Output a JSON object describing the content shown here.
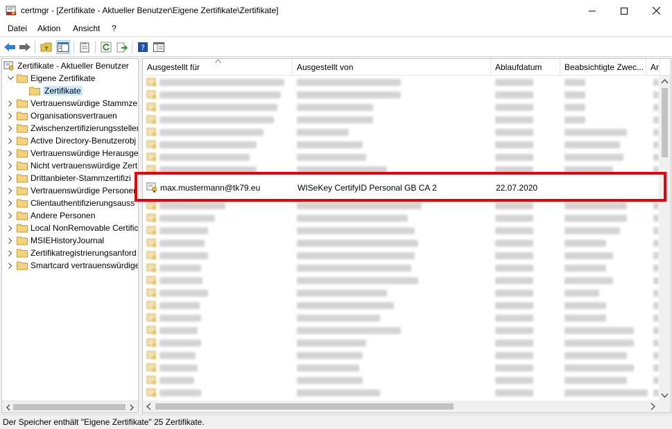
{
  "window": {
    "title": "certmgr - [Zertifikate - Aktueller Benutzer\\Eigene Zertifikate\\Zertifikate]",
    "icon": "certificate-manager-icon"
  },
  "menu": {
    "items": [
      {
        "label": "Datei"
      },
      {
        "label": "Aktion"
      },
      {
        "label": "Ansicht"
      },
      {
        "label": "?"
      }
    ]
  },
  "toolbar": {
    "icons": [
      "back-arrow-icon",
      "forward-arrow-icon",
      "up-folder-icon",
      "show-hide-tree-icon",
      "clipboard-icon",
      "refresh-icon",
      "export-list-icon",
      "help-icon",
      "console-icon"
    ]
  },
  "tree": {
    "root": "Zertifikate - Aktueller Benutzer",
    "eigene": "Eigene Zertifikate",
    "selected": "Zertifikate",
    "items": [
      "Vertrauenswürdige Stammzer",
      "Organisationsvertrauen",
      "Zwischenzertifizierungsstellen",
      "Active Directory-Benutzerobj",
      "Vertrauenswürdige Herausgel",
      "Nicht vertrauenswürdige Zert",
      "Drittanbieter-Stammzertifizi",
      "Vertrauenswürdige Personen",
      "Clientauthentifizierungsauss",
      "Andere Personen",
      "Local NonRemovable Certific",
      "MSIEHistoryJournal",
      "Zertifikatregistrierungsanford",
      "Smartcard vertrauenswürdige"
    ]
  },
  "list": {
    "columns": [
      {
        "label": "Ausgestellt für"
      },
      {
        "label": "Ausgestellt von"
      },
      {
        "label": "Ablaufdatum"
      },
      {
        "label": "Beabsichtigte Zwec..."
      },
      {
        "label": "Ar"
      }
    ],
    "highlighted": {
      "issued_to": "max.mustermann@tk79.eu",
      "issued_by": "WISeKey CertifyID Personal GB CA 2",
      "expiry": "22.07.2020"
    },
    "blurred_rows_before": 8,
    "blurred_rows_after": 16
  },
  "status": {
    "text": "Der Speicher enthält \"Eigene Zertifikate\" 25 Zertifikate."
  },
  "colors": {
    "highlight_border": "#e8000b",
    "selection": "#cce8ff",
    "folder": "#e8c14a"
  }
}
